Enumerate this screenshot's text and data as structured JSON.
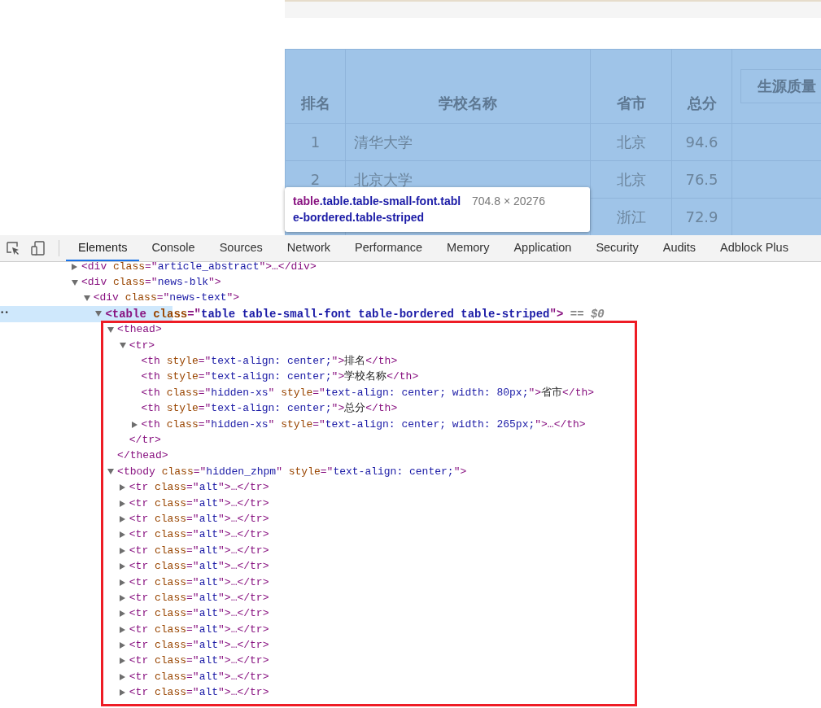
{
  "page_table": {
    "columns": [
      {
        "label": "排名",
        "kind": "plain"
      },
      {
        "label": "学校名称",
        "kind": "plain"
      },
      {
        "label": "省市",
        "kind": "plain"
      },
      {
        "label": "总分",
        "kind": "plain"
      },
      {
        "label": "生源质量",
        "kind": "button"
      }
    ],
    "rows": [
      {
        "rank": "1",
        "school": "清华大学",
        "province": "北京",
        "score": "94.6"
      },
      {
        "rank": "2",
        "school": "北京大学",
        "province": "北京",
        "score": "76.5"
      },
      {
        "province": "浙江",
        "score": "72.9"
      }
    ],
    "highlighted": true
  },
  "inspect_tooltip": {
    "tag": "table",
    "classes": ".table.table-small-font.table-bordered.table-striped",
    "size": "704.8 × 20276"
  },
  "devtools": {
    "tabs": [
      {
        "label": "Elements",
        "selected": true
      },
      {
        "label": "Console",
        "selected": false
      },
      {
        "label": "Sources",
        "selected": false
      },
      {
        "label": "Network",
        "selected": false
      },
      {
        "label": "Performance",
        "selected": false
      },
      {
        "label": "Memory",
        "selected": false
      },
      {
        "label": "Application",
        "selected": false
      },
      {
        "label": "Security",
        "selected": false
      },
      {
        "label": "Audits",
        "selected": false
      },
      {
        "label": "Adblock Plus",
        "selected": false
      }
    ],
    "tree": [
      {
        "expanded": false,
        "selected": false,
        "segments": [
          {
            "kind": "tag",
            "text": "<div "
          },
          {
            "kind": "attr",
            "text": "class"
          },
          {
            "kind": "tag",
            "text": "=\""
          },
          {
            "kind": "value",
            "text": "article_abstract"
          },
          {
            "kind": "tag",
            "text": "\">…</div>"
          }
        ]
      },
      {
        "expanded": true,
        "selected": false,
        "segments": [
          {
            "kind": "tag",
            "text": "<div "
          },
          {
            "kind": "attr",
            "text": "class"
          },
          {
            "kind": "tag",
            "text": "=\""
          },
          {
            "kind": "value",
            "text": "news-blk"
          },
          {
            "kind": "tag",
            "text": "\">"
          }
        ],
        "children": [
          {
            "expanded": true,
            "selected": false,
            "segments": [
              {
                "kind": "tag",
                "text": "<div "
              },
              {
                "kind": "attr",
                "text": "class"
              },
              {
                "kind": "tag",
                "text": "=\""
              },
              {
                "kind": "value",
                "text": "news-text"
              },
              {
                "kind": "tag",
                "text": "\">"
              }
            ],
            "children": [
              {
                "expanded": true,
                "selected": true,
                "gutter": "••",
                "segments": [
                  {
                    "kind": "tag",
                    "text": "<table "
                  },
                  {
                    "kind": "attr",
                    "text": "class"
                  },
                  {
                    "kind": "tag",
                    "text": "=\""
                  },
                  {
                    "kind": "value",
                    "text": "table table-small-font table-bordered table-striped"
                  },
                  {
                    "kind": "tag",
                    "text": "\">"
                  },
                  {
                    "kind": "hint",
                    "text": " == $0"
                  }
                ],
                "children": [
                  {
                    "expanded": true,
                    "selected": false,
                    "segments": [
                      {
                        "kind": "tag",
                        "text": "<thead>"
                      }
                    ],
                    "closing": "</thead>",
                    "children": [
                      {
                        "expanded": true,
                        "selected": false,
                        "segments": [
                          {
                            "kind": "tag",
                            "text": "<tr>"
                          }
                        ],
                        "closing": "</tr>",
                        "children": [
                          {
                            "selected": false,
                            "segments": [
                              {
                                "kind": "tag",
                                "text": "<th "
                              },
                              {
                                "kind": "attr",
                                "text": "style"
                              },
                              {
                                "kind": "tag",
                                "text": "=\""
                              },
                              {
                                "kind": "value",
                                "text": "text-align: center;"
                              },
                              {
                                "kind": "tag",
                                "text": "\">"
                              },
                              {
                                "kind": "text",
                                "text": "排名"
                              },
                              {
                                "kind": "tag",
                                "text": "</th>"
                              }
                            ]
                          },
                          {
                            "selected": false,
                            "segments": [
                              {
                                "kind": "tag",
                                "text": "<th "
                              },
                              {
                                "kind": "attr",
                                "text": "style"
                              },
                              {
                                "kind": "tag",
                                "text": "=\""
                              },
                              {
                                "kind": "value",
                                "text": "text-align: center;"
                              },
                              {
                                "kind": "tag",
                                "text": "\">"
                              },
                              {
                                "kind": "text",
                                "text": "学校名称"
                              },
                              {
                                "kind": "tag",
                                "text": "</th>"
                              }
                            ]
                          },
                          {
                            "selected": false,
                            "segments": [
                              {
                                "kind": "tag",
                                "text": "<th "
                              },
                              {
                                "kind": "attr",
                                "text": "class"
                              },
                              {
                                "kind": "tag",
                                "text": "=\""
                              },
                              {
                                "kind": "value",
                                "text": "hidden-xs"
                              },
                              {
                                "kind": "tag",
                                "text": "\" "
                              },
                              {
                                "kind": "attr",
                                "text": "style"
                              },
                              {
                                "kind": "tag",
                                "text": "=\""
                              },
                              {
                                "kind": "value",
                                "text": "text-align: center; width: 80px;"
                              },
                              {
                                "kind": "tag",
                                "text": "\">"
                              },
                              {
                                "kind": "text",
                                "text": "省市"
                              },
                              {
                                "kind": "tag",
                                "text": "</th>"
                              }
                            ]
                          },
                          {
                            "selected": false,
                            "segments": [
                              {
                                "kind": "tag",
                                "text": "<th "
                              },
                              {
                                "kind": "attr",
                                "text": "style"
                              },
                              {
                                "kind": "tag",
                                "text": "=\""
                              },
                              {
                                "kind": "value",
                                "text": "text-align: center;"
                              },
                              {
                                "kind": "tag",
                                "text": "\">"
                              },
                              {
                                "kind": "text",
                                "text": "总分"
                              },
                              {
                                "kind": "tag",
                                "text": "</th>"
                              }
                            ]
                          },
                          {
                            "expanded": false,
                            "selected": false,
                            "segments": [
                              {
                                "kind": "tag",
                                "text": "<th "
                              },
                              {
                                "kind": "attr",
                                "text": "class"
                              },
                              {
                                "kind": "tag",
                                "text": "=\""
                              },
                              {
                                "kind": "value",
                                "text": "hidden-xs"
                              },
                              {
                                "kind": "tag",
                                "text": "\" "
                              },
                              {
                                "kind": "attr",
                                "text": "style"
                              },
                              {
                                "kind": "tag",
                                "text": "=\""
                              },
                              {
                                "kind": "value",
                                "text": "text-align: center; width: 265px;"
                              },
                              {
                                "kind": "tag",
                                "text": "\">…</th>"
                              }
                            ]
                          }
                        ]
                      }
                    ]
                  },
                  {
                    "expanded": true,
                    "selected": false,
                    "segments": [
                      {
                        "kind": "tag",
                        "text": "<tbody "
                      },
                      {
                        "kind": "attr",
                        "text": "class"
                      },
                      {
                        "kind": "tag",
                        "text": "=\""
                      },
                      {
                        "kind": "value",
                        "text": "hidden_zhpm"
                      },
                      {
                        "kind": "tag",
                        "text": "\" "
                      },
                      {
                        "kind": "attr",
                        "text": "style"
                      },
                      {
                        "kind": "tag",
                        "text": "=\""
                      },
                      {
                        "kind": "value",
                        "text": "text-align: center;"
                      },
                      {
                        "kind": "tag",
                        "text": "\">"
                      }
                    ],
                    "children": [
                      {
                        "expanded": false,
                        "selected": false,
                        "segments": [
                          {
                            "kind": "tag",
                            "text": "<tr "
                          },
                          {
                            "kind": "attr",
                            "text": "class"
                          },
                          {
                            "kind": "tag",
                            "text": "=\""
                          },
                          {
                            "kind": "value",
                            "text": "alt"
                          },
                          {
                            "kind": "tag",
                            "text": "\">…</tr>"
                          }
                        ]
                      },
                      {
                        "expanded": false,
                        "selected": false,
                        "segments": [
                          {
                            "kind": "tag",
                            "text": "<tr "
                          },
                          {
                            "kind": "attr",
                            "text": "class"
                          },
                          {
                            "kind": "tag",
                            "text": "=\""
                          },
                          {
                            "kind": "value",
                            "text": "alt"
                          },
                          {
                            "kind": "tag",
                            "text": "\">…</tr>"
                          }
                        ]
                      },
                      {
                        "expanded": false,
                        "selected": false,
                        "segments": [
                          {
                            "kind": "tag",
                            "text": "<tr "
                          },
                          {
                            "kind": "attr",
                            "text": "class"
                          },
                          {
                            "kind": "tag",
                            "text": "=\""
                          },
                          {
                            "kind": "value",
                            "text": "alt"
                          },
                          {
                            "kind": "tag",
                            "text": "\">…</tr>"
                          }
                        ]
                      },
                      {
                        "expanded": false,
                        "selected": false,
                        "segments": [
                          {
                            "kind": "tag",
                            "text": "<tr "
                          },
                          {
                            "kind": "attr",
                            "text": "class"
                          },
                          {
                            "kind": "tag",
                            "text": "=\""
                          },
                          {
                            "kind": "value",
                            "text": "alt"
                          },
                          {
                            "kind": "tag",
                            "text": "\">…</tr>"
                          }
                        ]
                      },
                      {
                        "expanded": false,
                        "selected": false,
                        "segments": [
                          {
                            "kind": "tag",
                            "text": "<tr "
                          },
                          {
                            "kind": "attr",
                            "text": "class"
                          },
                          {
                            "kind": "tag",
                            "text": "=\""
                          },
                          {
                            "kind": "value",
                            "text": "alt"
                          },
                          {
                            "kind": "tag",
                            "text": "\">…</tr>"
                          }
                        ]
                      },
                      {
                        "expanded": false,
                        "selected": false,
                        "segments": [
                          {
                            "kind": "tag",
                            "text": "<tr "
                          },
                          {
                            "kind": "attr",
                            "text": "class"
                          },
                          {
                            "kind": "tag",
                            "text": "=\""
                          },
                          {
                            "kind": "value",
                            "text": "alt"
                          },
                          {
                            "kind": "tag",
                            "text": "\">…</tr>"
                          }
                        ]
                      },
                      {
                        "expanded": false,
                        "selected": false,
                        "segments": [
                          {
                            "kind": "tag",
                            "text": "<tr "
                          },
                          {
                            "kind": "attr",
                            "text": "class"
                          },
                          {
                            "kind": "tag",
                            "text": "=\""
                          },
                          {
                            "kind": "value",
                            "text": "alt"
                          },
                          {
                            "kind": "tag",
                            "text": "\">…</tr>"
                          }
                        ]
                      },
                      {
                        "expanded": false,
                        "selected": false,
                        "segments": [
                          {
                            "kind": "tag",
                            "text": "<tr "
                          },
                          {
                            "kind": "attr",
                            "text": "class"
                          },
                          {
                            "kind": "tag",
                            "text": "=\""
                          },
                          {
                            "kind": "value",
                            "text": "alt"
                          },
                          {
                            "kind": "tag",
                            "text": "\">…</tr>"
                          }
                        ]
                      },
                      {
                        "expanded": false,
                        "selected": false,
                        "segments": [
                          {
                            "kind": "tag",
                            "text": "<tr "
                          },
                          {
                            "kind": "attr",
                            "text": "class"
                          },
                          {
                            "kind": "tag",
                            "text": "=\""
                          },
                          {
                            "kind": "value",
                            "text": "alt"
                          },
                          {
                            "kind": "tag",
                            "text": "\">…</tr>"
                          }
                        ]
                      },
                      {
                        "expanded": false,
                        "selected": false,
                        "segments": [
                          {
                            "kind": "tag",
                            "text": "<tr "
                          },
                          {
                            "kind": "attr",
                            "text": "class"
                          },
                          {
                            "kind": "tag",
                            "text": "=\""
                          },
                          {
                            "kind": "value",
                            "text": "alt"
                          },
                          {
                            "kind": "tag",
                            "text": "\">…</tr>"
                          }
                        ]
                      },
                      {
                        "expanded": false,
                        "selected": false,
                        "segments": [
                          {
                            "kind": "tag",
                            "text": "<tr "
                          },
                          {
                            "kind": "attr",
                            "text": "class"
                          },
                          {
                            "kind": "tag",
                            "text": "=\""
                          },
                          {
                            "kind": "value",
                            "text": "alt"
                          },
                          {
                            "kind": "tag",
                            "text": "\">…</tr>"
                          }
                        ]
                      },
                      {
                        "expanded": false,
                        "selected": false,
                        "segments": [
                          {
                            "kind": "tag",
                            "text": "<tr "
                          },
                          {
                            "kind": "attr",
                            "text": "class"
                          },
                          {
                            "kind": "tag",
                            "text": "=\""
                          },
                          {
                            "kind": "value",
                            "text": "alt"
                          },
                          {
                            "kind": "tag",
                            "text": "\">…</tr>"
                          }
                        ]
                      },
                      {
                        "expanded": false,
                        "selected": false,
                        "segments": [
                          {
                            "kind": "tag",
                            "text": "<tr "
                          },
                          {
                            "kind": "attr",
                            "text": "class"
                          },
                          {
                            "kind": "tag",
                            "text": "=\""
                          },
                          {
                            "kind": "value",
                            "text": "alt"
                          },
                          {
                            "kind": "tag",
                            "text": "\">…</tr>"
                          }
                        ]
                      },
                      {
                        "expanded": false,
                        "selected": false,
                        "segments": [
                          {
                            "kind": "tag",
                            "text": "<tr "
                          },
                          {
                            "kind": "attr",
                            "text": "class"
                          },
                          {
                            "kind": "tag",
                            "text": "=\""
                          },
                          {
                            "kind": "value",
                            "text": "alt"
                          },
                          {
                            "kind": "tag",
                            "text": "\">…</tr>"
                          }
                        ]
                      }
                    ]
                  }
                ]
              }
            ]
          }
        ]
      }
    ],
    "highlight_box": true
  }
}
